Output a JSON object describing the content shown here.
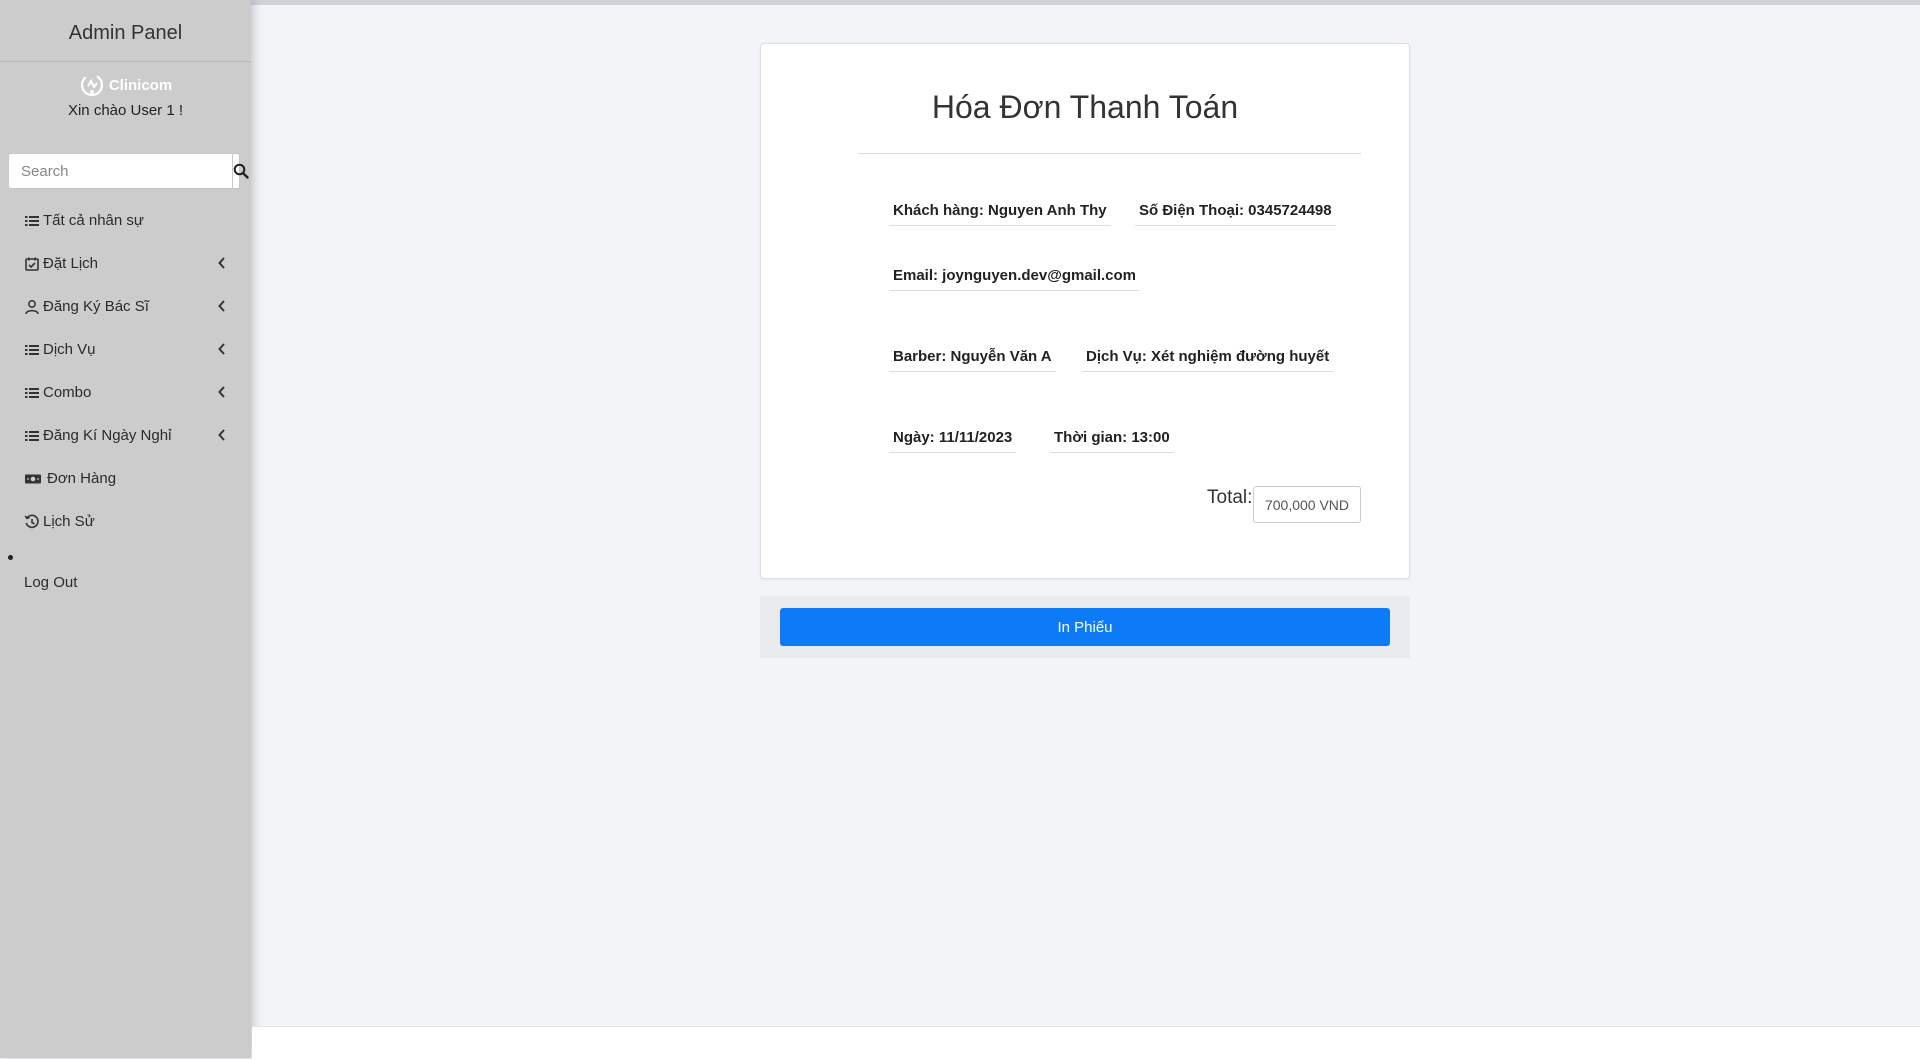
{
  "sidebar": {
    "title": "Admin Panel",
    "brand": "Clinicom",
    "greeting": "Xin chào User 1 !",
    "search_placeholder": "Search",
    "items": [
      {
        "label": "Tất cả nhân sự",
        "icon": "list-icon",
        "expandable": false
      },
      {
        "label": "Đặt Lịch",
        "icon": "calendar-check-icon",
        "expandable": true
      },
      {
        "label": "Đăng Ký Bác Sĩ",
        "icon": "user-icon",
        "expandable": true
      },
      {
        "label": "Dịch Vụ",
        "icon": "list-icon",
        "expandable": true
      },
      {
        "label": "Combo",
        "icon": "list-icon",
        "expandable": true
      },
      {
        "label": "Đăng Kí Ngày Nghỉ",
        "icon": "list-icon",
        "expandable": true
      },
      {
        "label": "Đơn Hàng",
        "icon": "money-bill-icon",
        "expandable": false
      },
      {
        "label": "Lịch Sử",
        "icon": "history-icon",
        "expandable": false
      }
    ],
    "logout": "Log Out"
  },
  "invoice": {
    "title": "Hóa Đơn Thanh Toán",
    "customer": "Khách hàng: Nguyen Anh Thy",
    "phone": "Số Điện Thoại: 0345724498",
    "email": "Email: joynguyen.dev@gmail.com",
    "barber": "Barber: Nguyễn Văn A",
    "service": "Dịch Vụ: Xét nghiệm đường huyết",
    "date": "Ngày: 11/11/2023",
    "time": "Thời gian: 13:00",
    "total_label": "Total:",
    "total_value": "700,000 VND"
  },
  "actions": {
    "print_label": "In Phiếu"
  },
  "colors": {
    "sidebar_bg": "#cccccc",
    "primary": "#0d7bf7",
    "page_bg": "#f3f4f8"
  }
}
